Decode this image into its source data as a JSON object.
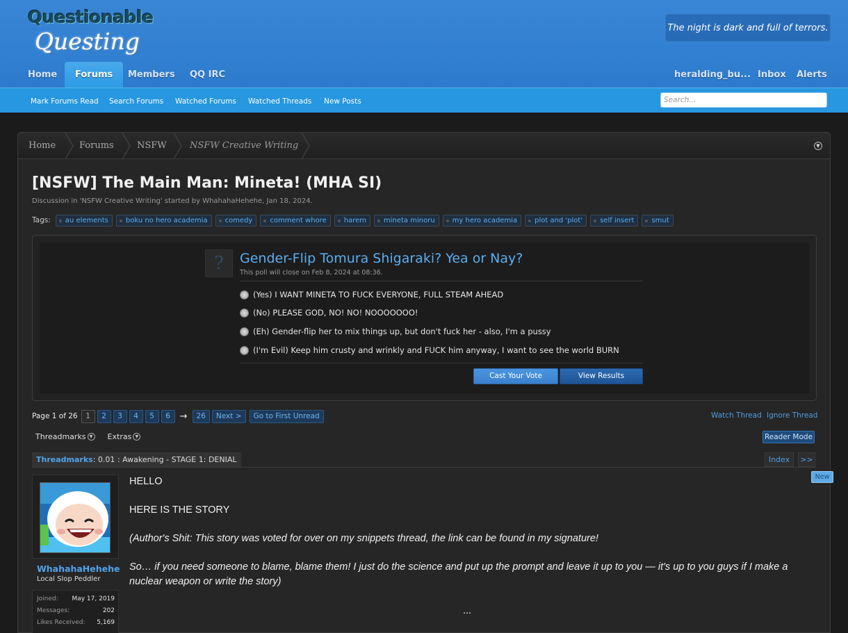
{
  "header": {
    "logo_top": "Questionable",
    "logo_bottom": "Questing",
    "tagline": "The night is dark and full of terrors.",
    "tabs": [
      "Home",
      "Forums",
      "Members",
      "QQ IRC"
    ],
    "user_links": [
      "heralding_bu...",
      "Inbox",
      "Alerts"
    ]
  },
  "subnav": {
    "links": [
      "Mark Forums Read",
      "Search Forums",
      "Watched Forums",
      "Watched Threads",
      "New Posts"
    ],
    "search_placeholder": "Search..."
  },
  "breadcrumb": [
    "Home",
    "Forums",
    "NSFW",
    "NSFW Creative Writing"
  ],
  "thread": {
    "title": "[NSFW] The Main Man: Mineta! (MHA SI)",
    "meta": "Discussion in 'NSFW Creative Writing' started by WhahahaHehehe, Jan 18, 2024.",
    "tags_label": "Tags:",
    "tags": [
      "au elements",
      "boku no hero academia",
      "comedy",
      "comment whore",
      "harem",
      "mineta minoru",
      "my hero academia",
      "plot and 'plot'",
      "self insert",
      "smut"
    ]
  },
  "poll": {
    "icon": "?",
    "question": "Gender-Flip Tomura Shigaraki? Yea or Nay?",
    "close_text": "This poll will close on Feb 8, 2024 at 08:36.",
    "options": [
      "(Yes) I WANT MINETA TO FUCK EVERYONE, FULL STEAM AHEAD",
      "(No) PLEASE GOD, NO! NO! NOOOOOOO!",
      "(Eh) Gender-flip her to mix things up, but don't fuck her - also, I'm a pussy",
      "(I'm Evil) Keep him crusty and wrinkly and FUCK him anyway, I want to see the world BURN"
    ],
    "vote_label": "Cast Your Vote",
    "results_label": "View Results"
  },
  "pager": {
    "label": "Page 1 of 26",
    "pages": [
      "1",
      "2",
      "3",
      "4",
      "5",
      "6"
    ],
    "arrow": "→",
    "last": "26",
    "next": "Next >",
    "first_unread": "Go to First Unread",
    "watch": "Watch Thread",
    "ignore": "Ignore Thread"
  },
  "threadmarks": {
    "menu": "Threadmarks",
    "extras": "Extras",
    "reader_mode": "Reader Mode",
    "bar_label": "Threadmarks",
    "bar_value": ": 0.01 : Awakening - STAGE 1: DENIAL",
    "index": "Index",
    "next": ">>",
    "new_badge": "New"
  },
  "author": {
    "name": "WhahahaHehehe",
    "title": "Local Slop Peddler",
    "stats": [
      {
        "k": "Joined:",
        "v": "May 17, 2019"
      },
      {
        "k": "Messages:",
        "v": "202"
      },
      {
        "k": "Likes Received:",
        "v": "5,169"
      }
    ]
  },
  "post": {
    "lines": [
      "HELLO",
      "HERE IS THE STORY",
      "(Author's Shit: This story was voted for over on my snippets thread, the link can be found in my signature!",
      "So… if you need someone to blame, blame them! I just do the science and put up the prompt and leave it up to you — it's up to you guys if I make a",
      "nuclear weapon or write the story)",
      "..."
    ]
  }
}
